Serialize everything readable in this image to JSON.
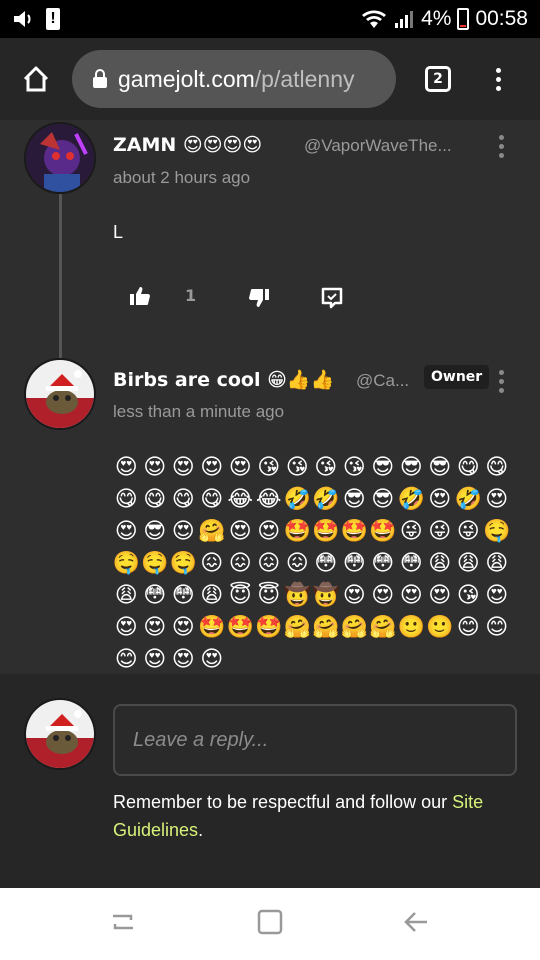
{
  "status_bar": {
    "battery": "4%",
    "time": "00:58",
    "icons": [
      "volume-icon",
      "alert-icon",
      "wifi-icon",
      "signal-icon",
      "battery-icon"
    ]
  },
  "browser": {
    "url_host": "gamejolt.com",
    "url_path": "/p/atlenny",
    "tab_count": "2",
    "icons": [
      "home-icon",
      "lock-icon",
      "tabs-icon",
      "menu-icon"
    ]
  },
  "comments": [
    {
      "name": "ZAMN 😍😍😍😍",
      "handle": "@VaporWaveThe...",
      "time": "about 2 hours ago",
      "body": "L",
      "like_count": "1"
    },
    {
      "name": "Birbs are cool 😁👍👍",
      "handle": "@Ca...",
      "badge": "Owner",
      "time": "less than a minute ago",
      "body_emojis": "😍😍😍😍😍😘😘😘😘😎😎😎😋😋😋😋😋😋😂😂🤣🤣😎😎🤣😍🤣😍😍😎😍🤗😍😍🤩🤩🤩🤩😜😜😜🤤🤤🤤🤤😖😖😖😖😳😳😳😳😩😩😩😩😳😳😩😇😇🤠🤠😍😍😍😍😘😍😍😍😍🤩🤩🤩🤗🤗🤗🤗🙂🙂😊😊😊😍😍😍"
    }
  ],
  "reply": {
    "placeholder": "Leave a reply...",
    "note_prefix": "Remember to be respectful and follow our ",
    "note_link": "Site Guidelines",
    "note_suffix": "."
  },
  "nav_icons": [
    "recent-apps-icon",
    "home-nav-icon",
    "back-icon"
  ]
}
